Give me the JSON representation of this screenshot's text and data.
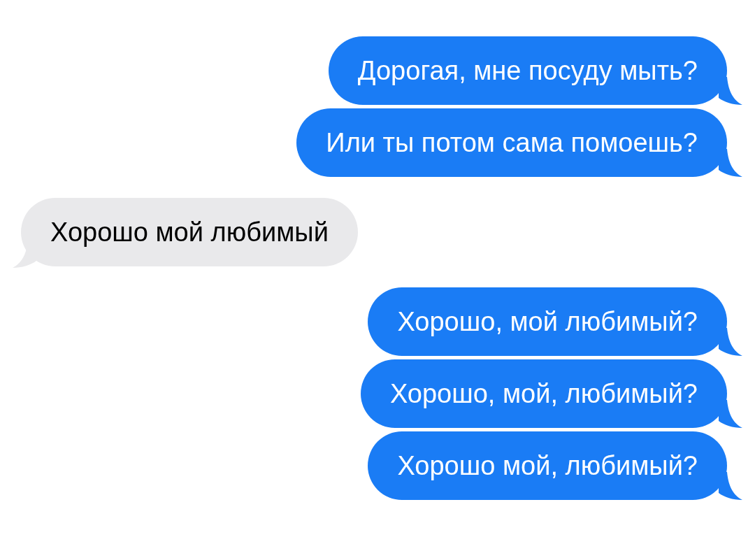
{
  "messages": [
    {
      "kind": "outgoing",
      "text": "Дорогая, мне посуду мыть?"
    },
    {
      "kind": "outgoing",
      "text": "Или ты потом сама помоешь?"
    },
    {
      "kind": "incoming",
      "text": "Хорошо мой любимый"
    },
    {
      "kind": "outgoing",
      "text": "Хорошо, мой любимый?"
    },
    {
      "kind": "outgoing",
      "text": "Хорошо, мой, любимый?"
    },
    {
      "kind": "outgoing",
      "text": "Хорошо мой, любимый?"
    }
  ]
}
